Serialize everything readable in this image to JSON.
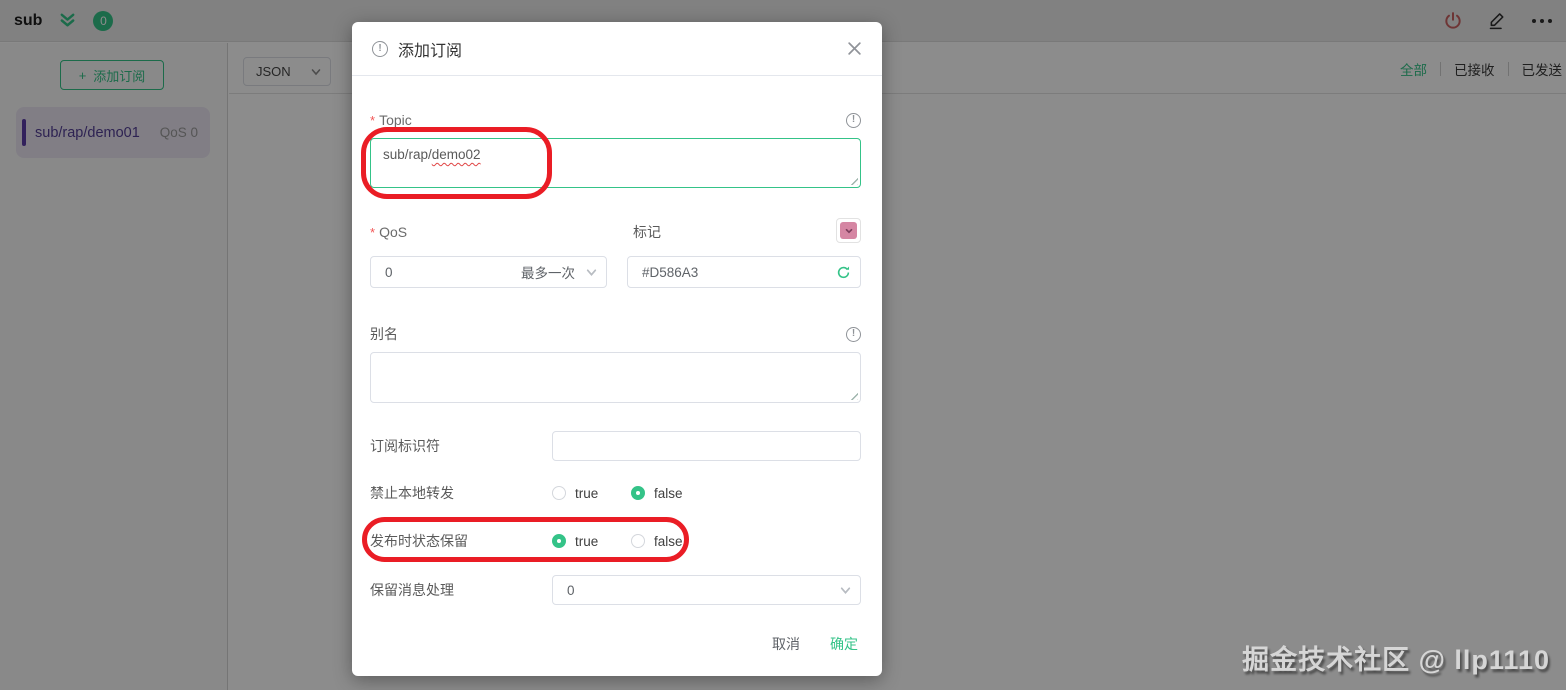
{
  "topbar": {
    "connection_name": "sub",
    "unread_count": "0"
  },
  "sidebar": {
    "add_button": {
      "plus": "+",
      "label": "添加订阅"
    },
    "subscriptions": [
      {
        "topic": "sub/rap/demo01",
        "qos": "QoS 0"
      }
    ]
  },
  "toolbar": {
    "format_select": {
      "value": "JSON"
    },
    "tabs": [
      {
        "label": "全部"
      },
      {
        "label": "已接收"
      },
      {
        "label": "已发送"
      }
    ]
  },
  "modal": {
    "title": "添加订阅",
    "required_mark": "*",
    "topic": {
      "label": "Topic",
      "value_prefix": "sub/rap/",
      "value_typo": "demo02"
    },
    "qos": {
      "label": "QoS",
      "value": "0",
      "value_desc": "最多一次"
    },
    "tag": {
      "label": "标记",
      "value": "#D586A3"
    },
    "alias": {
      "label": "别名",
      "value": ""
    },
    "sub_identifier": {
      "label": "订阅标识符",
      "value": ""
    },
    "no_local": {
      "label": "禁止本地转发",
      "option_true": "true",
      "option_false": "false",
      "selected": "false"
    },
    "retain_as_published": {
      "label": "发布时状态保留",
      "option_true": "true",
      "option_false": "false",
      "selected": "true"
    },
    "retain_handling": {
      "label": "保留消息处理",
      "value": "0"
    },
    "footer": {
      "cancel": "取消",
      "confirm": "确定"
    }
  },
  "watermark": "掘金技术社区 @ llp1110",
  "colors": {
    "accent_green": "#34c388",
    "tag_color": "#D586A3",
    "annotation_red": "#ea1d25",
    "subscription_purple": "#5b3da8"
  }
}
